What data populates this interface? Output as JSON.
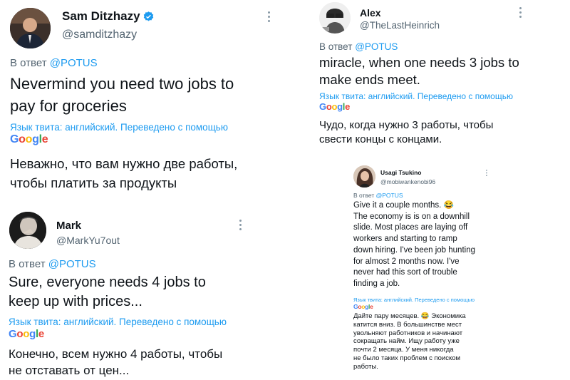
{
  "tweets": [
    {
      "name": "Sam Ditzhazy",
      "handle": "@samditzhazy",
      "reply_prefix": "В ответ",
      "reply_to": "@POTUS",
      "original_lines": [
        "Nevermind you need two jobs to",
        "pay for groceries"
      ],
      "translated_note": "Язык твита: английский. Переведено с помощью",
      "google": [
        "G",
        "o",
        "o",
        "g",
        "l",
        "e"
      ],
      "translation_lines": [
        "Неважно, что вам нужно две работы,",
        "чтобы платить за продукты"
      ]
    },
    {
      "name": "Mark",
      "handle": "@MarkYu7out",
      "reply_prefix": "В ответ",
      "reply_to": "@POTUS",
      "original_lines": [
        "Sure, everyone needs 4 jobs to",
        "keep up with prices..."
      ],
      "translated_note": "Язык твита: английский. Переведено с помощью",
      "google": [
        "G",
        "o",
        "o",
        "g",
        "l",
        "e"
      ],
      "translation_lines": [
        "Конечно, всем нужно 4 работы, чтобы",
        "не отставать от цен..."
      ]
    },
    {
      "name": "Alex",
      "handle": "@TheLastHeinrich",
      "reply_prefix": "В ответ",
      "reply_to": "@POTUS",
      "original_lines": [
        "miracle, when one needs 3 jobs to",
        "make ends meet."
      ],
      "translated_note": "Язык твита: английский. Переведено с помощью",
      "google": [
        "G",
        "o",
        "o",
        "g",
        "l",
        "e"
      ],
      "translation_lines": [
        "Чудо, когда нужно 3 работы, чтобы",
        "свести концы с концами."
      ]
    },
    {
      "name": "Usagi Tsukino",
      "handle": "@mobiwankenobi96",
      "reply_prefix": "В ответ",
      "reply_to": "@POTUS",
      "original_lines": [
        "Give it a couple months. 😂",
        "The economy is is on a downhill",
        "slide. Most places are laying off",
        "workers and starting to ramp",
        "down hiring. I've been job hunting",
        "for almost 2 months now. I've",
        "never had this sort of trouble",
        "finding a job."
      ],
      "translated_note": "Язык твита: английский. Переведено с помощью",
      "google": [
        "G",
        "o",
        "o",
        "g",
        "l",
        "e"
      ],
      "translation_lines": [
        "Дайте пару месяцев. 😂 Экономика",
        "катится вниз. В большинстве мест",
        "увольняют работников и начинают",
        "сокращать найм. Ищу работу уже",
        "почти 2 месяца. У меня никогда",
        "не было таких проблем с поиском",
        "работы."
      ]
    }
  ],
  "colors": {
    "link": "#1d9bf0",
    "secondary": "#536471",
    "text": "#0f1419",
    "verified": "#1d9bf0"
  }
}
